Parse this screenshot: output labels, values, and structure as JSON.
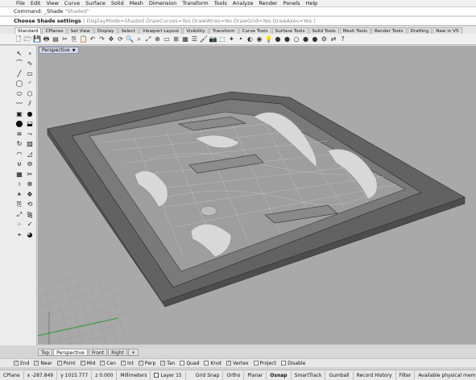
{
  "menu": [
    "File",
    "Edit",
    "View",
    "Curve",
    "Surface",
    "Solid",
    "Mesh",
    "Dimension",
    "Transform",
    "Tools",
    "Analyze",
    "Render",
    "Panels",
    "Help"
  ],
  "command_history": {
    "label": "Command:",
    "text": "_Shade",
    "value": "\"Shaded\""
  },
  "command_prompt": {
    "label": "Choose Shade settings",
    "options": "( DisplayMode=Shaded  DrawCurves=Yes  DrawWires=No  DrawGrid=Yes  DrawAxes=Yes )"
  },
  "toolbar_tabs": [
    "Standard",
    "CPlanes",
    "Set View",
    "Display",
    "Select",
    "Viewport Layout",
    "Visibility",
    "Transform",
    "Curve Tools",
    "Surface Tools",
    "Solid Tools",
    "Mesh Tools",
    "Render Tools",
    "Drafting",
    "New in V5"
  ],
  "active_tab": "Standard",
  "toolbar_icons": [
    "new-icon",
    "open-icon",
    "save-icon",
    "print-icon",
    "properties-icon",
    "cut-icon",
    "copy-icon",
    "paste-icon",
    "undo-icon",
    "redo-icon",
    "pan-icon",
    "rotate-icon",
    "zoom-icon",
    "zoom-window-icon",
    "zoom-extents-icon",
    "zoom-selected-icon",
    "viewport-icon",
    "four-views-icon",
    "grid-icon",
    "layer-icon",
    "paint-icon",
    "camera-icon",
    "select-icon",
    "light-icon",
    "point-icon",
    "material-icon",
    "render-icon",
    "bulb-icon",
    "shaded-sphere-icon",
    "rendered-sphere-icon",
    "ghosted-sphere-icon",
    "color-sphere-icon",
    "dark-sphere-icon",
    "settings-icon",
    "toggle-icon",
    "help-icon"
  ],
  "viewport": {
    "label": "Perspective"
  },
  "view_tabs": [
    "Top",
    "Perspective",
    "Front",
    "Right"
  ],
  "active_view": "Perspective",
  "osnaps": [
    {
      "label": "End",
      "checked": true
    },
    {
      "label": "Near",
      "checked": true
    },
    {
      "label": "Point",
      "checked": true
    },
    {
      "label": "Mid",
      "checked": true
    },
    {
      "label": "Cen",
      "checked": true
    },
    {
      "label": "Int",
      "checked": true
    },
    {
      "label": "Perp",
      "checked": true
    },
    {
      "label": "Tan",
      "checked": true
    },
    {
      "label": "Quad",
      "checked": false
    },
    {
      "label": "Knot",
      "checked": false
    },
    {
      "label": "Vertex",
      "checked": true
    },
    {
      "label": "Project",
      "checked": false
    },
    {
      "label": "Disable",
      "checked": false
    }
  ],
  "status": {
    "cplane": "CPlane",
    "x": "x -287.849",
    "y": "y 1015.777",
    "z": "z 0.000",
    "units": "Millimeters",
    "layer": "Layer 15",
    "grid_snap": "Grid Snap",
    "ortho": "Ortho",
    "planar": "Planar",
    "osnap": "Osnap",
    "smarttrack": "SmartTrack",
    "gumball": "Gumball",
    "record_history": "Record History",
    "filter": "Filter",
    "memory": "Available physical mem"
  },
  "colors": {
    "viewport_bg": "#a9a9a9",
    "grid_axis_green": "#2f9a3a",
    "active_osnap_bold": "#000000"
  }
}
